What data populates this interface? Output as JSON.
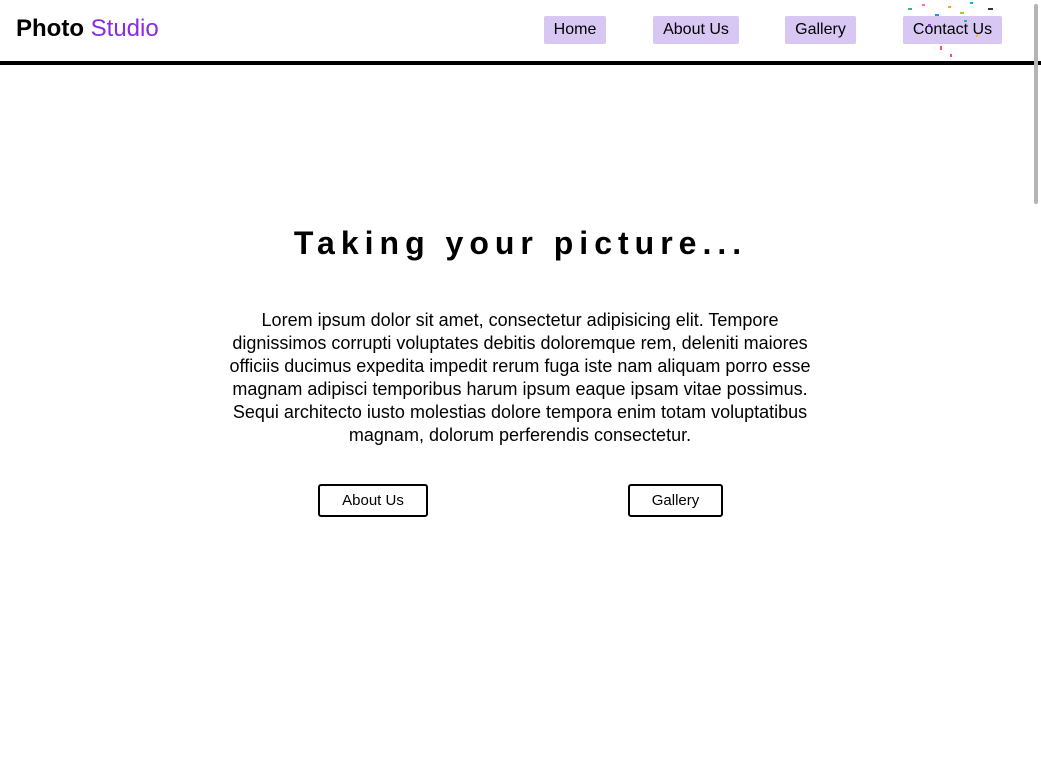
{
  "header": {
    "logo_primary": "Photo",
    "logo_secondary": "Studio",
    "nav": [
      {
        "label": "Home"
      },
      {
        "label": "About Us"
      },
      {
        "label": "Gallery"
      },
      {
        "label": "Contact Us"
      }
    ]
  },
  "hero": {
    "title": "Taking your picture...",
    "body": "Lorem ipsum dolor sit amet, consectetur adipisicing elit. Tempore dignissimos corrupti voluptates debitis doloremque rem, deleniti maiores officiis ducimus expedita impedit rerum fuga iste nam aliquam porro esse magnam adipisci temporibus harum ipsum eaque ipsam vitae possimus. Sequi architecto iusto molestias dolore tempora enim totam voluptatibus magnam, dolorum perferendis consectetur.",
    "buttons": [
      {
        "label": "About Us"
      },
      {
        "label": "Gallery"
      }
    ]
  },
  "colors": {
    "accent": "#8a2be2",
    "nav_button_bg": "#d8c6f3",
    "header_rule": "#000000"
  }
}
